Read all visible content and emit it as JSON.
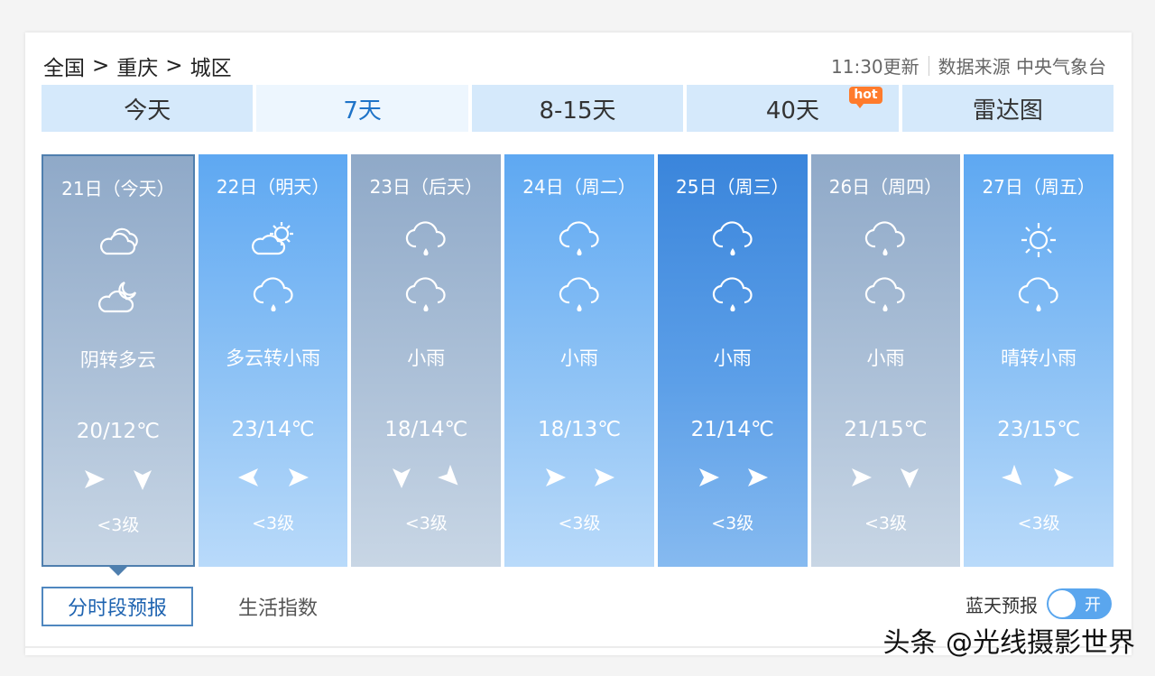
{
  "breadcrumb": {
    "country": "全国",
    "city": "重庆",
    "district": "城区",
    "separator": ">"
  },
  "meta": {
    "update_time": "11:30更新",
    "source": "数据来源 中央气象台"
  },
  "tabs": [
    {
      "label": "今天"
    },
    {
      "label": "7天"
    },
    {
      "label": "8-15天"
    },
    {
      "label": "40天",
      "badge": "hot"
    },
    {
      "label": "雷达图"
    }
  ],
  "days": [
    {
      "date": "21日（今天）",
      "icon_day": "cloudy-icon",
      "icon_night": "cloudy-night-icon",
      "weather": "阴转多云",
      "temp": "20/12℃",
      "wind_dirs": [
        "east",
        "south"
      ],
      "wind_level": "<3级"
    },
    {
      "date": "22日（明天）",
      "icon_day": "partly-cloudy-icon",
      "icon_night": "light-rain-icon",
      "weather": "多云转小雨",
      "temp": "23/14℃",
      "wind_dirs": [
        "west",
        "east"
      ],
      "wind_level": "<3级"
    },
    {
      "date": "23日（后天）",
      "icon_day": "light-rain-icon",
      "icon_night": "light-rain-icon",
      "weather": "小雨",
      "temp": "18/14℃",
      "wind_dirs": [
        "south",
        "southeast"
      ],
      "wind_level": "<3级"
    },
    {
      "date": "24日（周二）",
      "icon_day": "light-rain-icon",
      "icon_night": "light-rain-icon",
      "weather": "小雨",
      "temp": "18/13℃",
      "wind_dirs": [
        "east",
        "east"
      ],
      "wind_level": "<3级"
    },
    {
      "date": "25日（周三）",
      "icon_day": "light-rain-icon",
      "icon_night": "light-rain-icon",
      "weather": "小雨",
      "temp": "21/14℃",
      "wind_dirs": [
        "east",
        "east"
      ],
      "wind_level": "<3级"
    },
    {
      "date": "26日（周四）",
      "icon_day": "light-rain-icon",
      "icon_night": "light-rain-icon",
      "weather": "小雨",
      "temp": "21/15℃",
      "wind_dirs": [
        "east",
        "south"
      ],
      "wind_level": "<3级"
    },
    {
      "date": "27日（周五）",
      "icon_day": "sunny-icon",
      "icon_night": "light-rain-icon",
      "weather": "晴转小雨",
      "temp": "23/15℃",
      "wind_dirs": [
        "southeast",
        "east"
      ],
      "wind_level": "<3级"
    }
  ],
  "bottom_tabs": [
    {
      "label": "分时段预报"
    },
    {
      "label": "生活指数"
    }
  ],
  "blue_sky": {
    "label": "蓝天预报",
    "toggle_text": "开"
  },
  "watermark": "头条 @光线摄影世界"
}
